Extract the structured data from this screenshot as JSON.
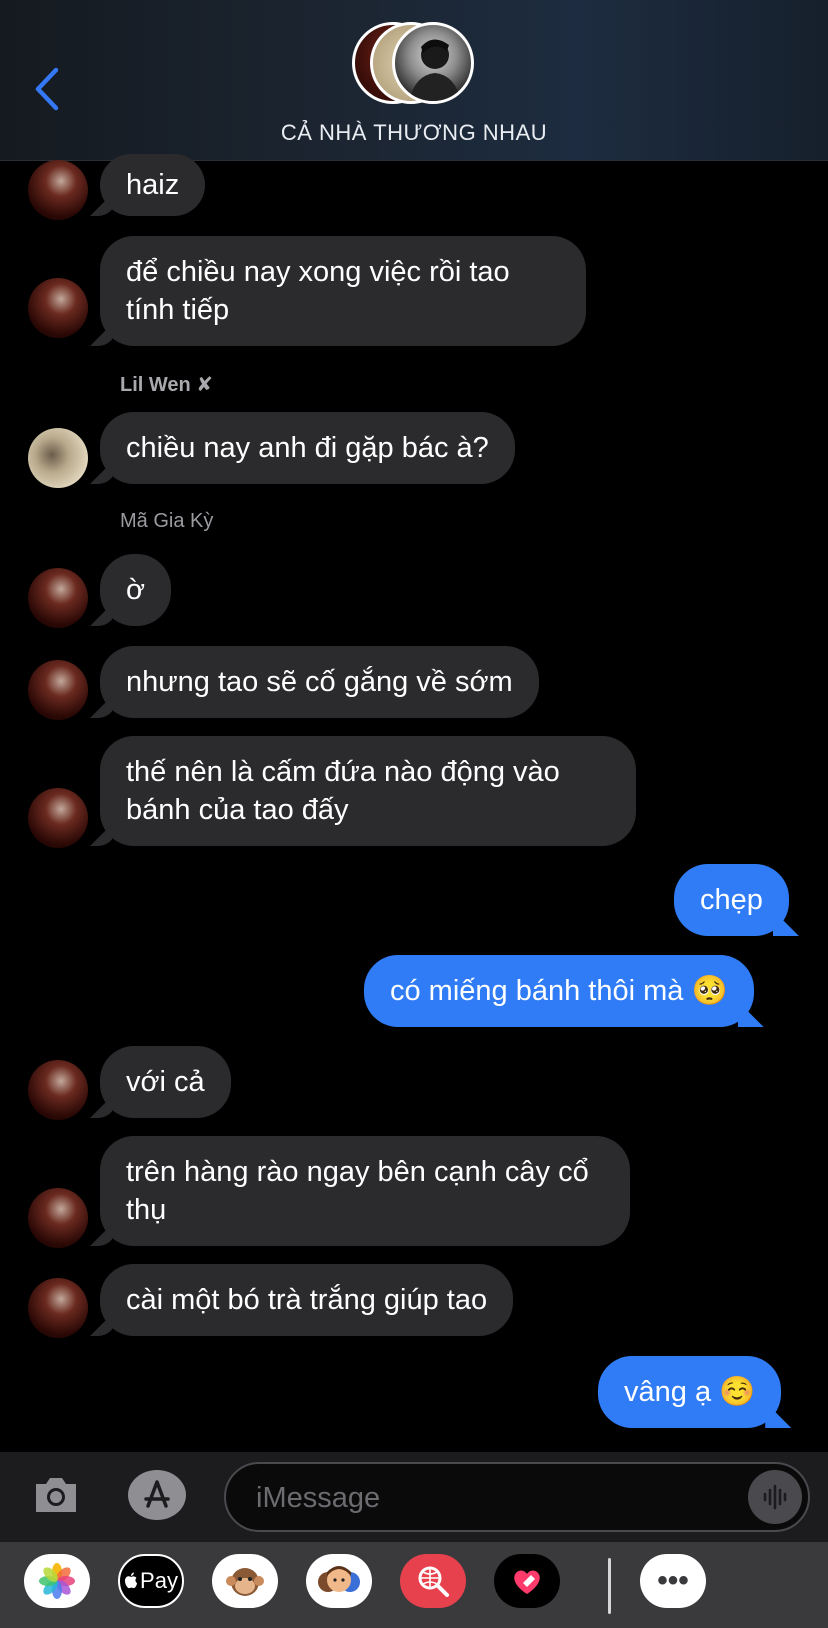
{
  "header": {
    "title": "CẢ NHÀ THƯƠNG NHAU"
  },
  "messages": [
    {
      "text": "haiz"
    },
    {
      "text": "để chiều nay xong việc rồi tao tính tiếp"
    },
    {
      "sender": "Lil Wen ✘"
    },
    {
      "text": "chiều nay anh đi gặp bác à?"
    },
    {
      "sender": "Mã Gia Kỳ"
    },
    {
      "text": "ờ"
    },
    {
      "text": "nhưng tao sẽ cố gắng về sớm"
    },
    {
      "text": "thế nên là cấm đứa nào động vào bánh của tao đấy"
    },
    {
      "text": "chẹp"
    },
    {
      "text": "có miếng bánh thôi mà 🥺"
    },
    {
      "text": "với cả"
    },
    {
      "text": "trên hàng rào ngay bên cạnh cây cổ thụ"
    },
    {
      "text": "cài một bó trà trắng giúp tao"
    },
    {
      "text": "vâng ạ ☺️"
    }
  ],
  "input": {
    "placeholder": "iMessage"
  },
  "app_drawer": {
    "apple_pay_label": "Pay",
    "more_label": "•••"
  },
  "colors": {
    "outgoing_bubble": "#2f7cf6",
    "incoming_bubble": "#2b2b2e",
    "accent": "#3478f6"
  }
}
